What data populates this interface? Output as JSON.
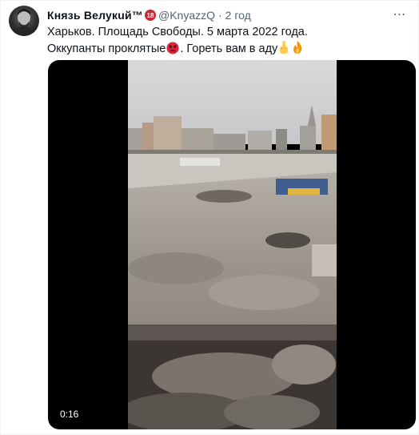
{
  "tweet": {
    "author": {
      "display_name": "Князь Велукuй™",
      "badge": "18",
      "handle": "@KnyazzQ",
      "avatar_icon": "person-avatar"
    },
    "separator": "·",
    "timestamp": "2 год",
    "more_icon": "more-horizontal-icon",
    "text_lines": [
      "Харьков. Площадь Свободы. 5 марта 2022 года.",
      "Оккупанты проклятые",
      ". Гореть вам в аду"
    ],
    "emojis": [
      "angry-face-emoji",
      "middle-finger-emoji",
      "fire-emoji"
    ],
    "media": {
      "type": "video",
      "duration": "0:16",
      "thumbnail_description_icon": "video-thumbnail"
    }
  },
  "colors": {
    "text": "#0f1419",
    "secondary": "#536471",
    "badge": "#c62833",
    "media_bg": "#000000"
  }
}
